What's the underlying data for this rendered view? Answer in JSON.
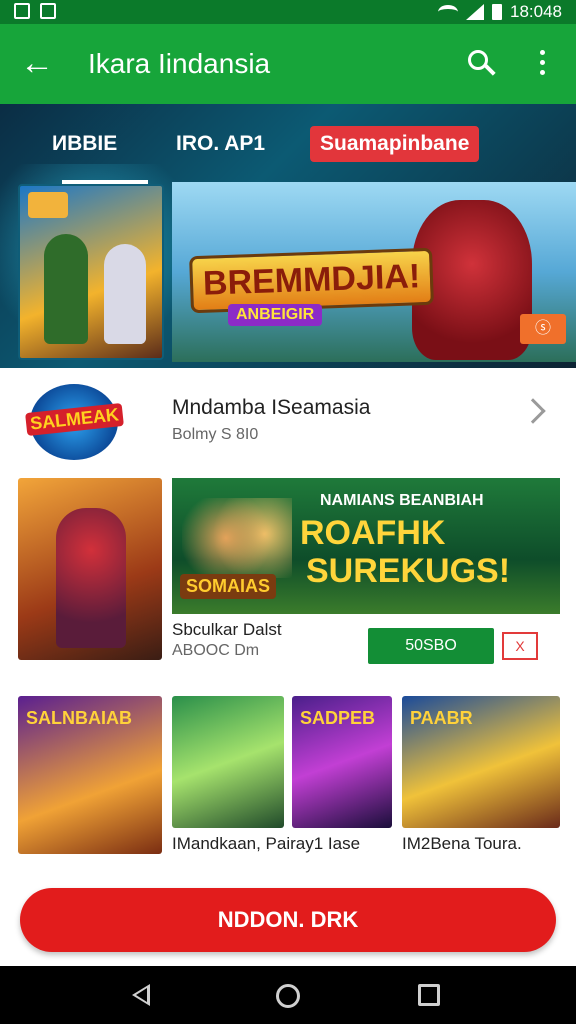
{
  "status_bar": {
    "time": "18:048"
  },
  "app_bar": {
    "title": "Ikara Iindansia"
  },
  "tabs": [
    {
      "label": "ИBBIE"
    },
    {
      "label": "IRO. AP1"
    },
    {
      "label": "Suamapinbane"
    }
  ],
  "hero": {
    "banner_logo": "BREMMDJIA!",
    "banner_sublogo": "ANBEIGIR",
    "badge_label": "ⓢ"
  },
  "featured_app": {
    "icon_text": "SALMEAK",
    "title": "Mndamba ISeamasia",
    "subtitle": "Bolmy S 8I0"
  },
  "promo": {
    "banner_line1": "NAMIANS BEANBIAH",
    "banner_line2": "ROAFHK",
    "banner_line3": "SUREKUGS!",
    "banner_tag": "SOMAIAS",
    "title": "Sbculkar Dalst",
    "subtitle": "ABOOC Dm",
    "install_label": "50SBO",
    "dismiss_label": "X"
  },
  "grid": {
    "tile1_label": "SALNBAIAB",
    "tile3_label": "SADPEB",
    "tile4_label": "PAABR",
    "caption_left": "IMandkaan, Pairay1 Iase",
    "caption_right": "IM2Bena Toura."
  },
  "cta": {
    "label": "NDDON. DRK"
  },
  "colors": {
    "app_bar": "#17a53a",
    "status_bar": "#0b7a2a",
    "cta": "#e21c1c",
    "install": "#138e36"
  }
}
